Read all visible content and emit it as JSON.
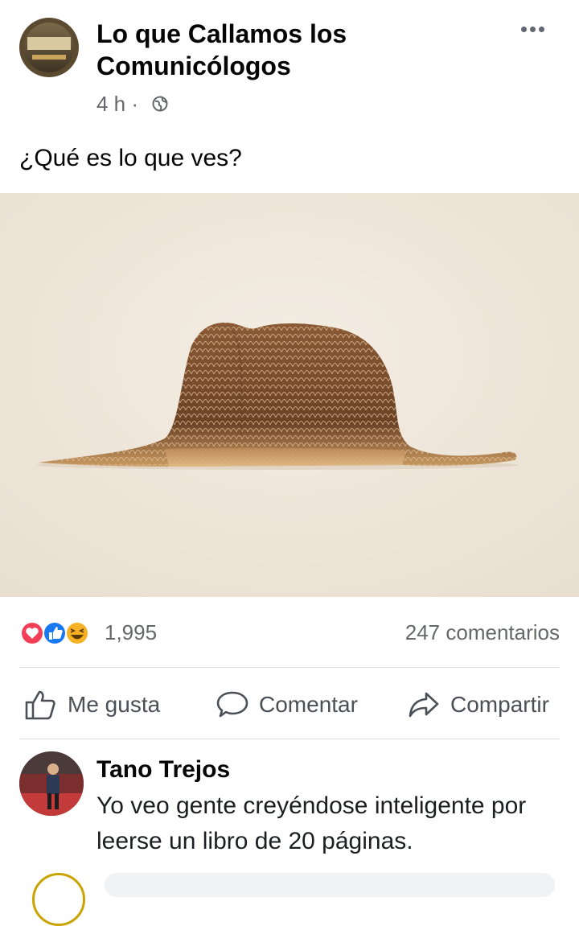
{
  "post": {
    "page_name": "Lo que Callamos los Comunicólogos",
    "time": "4 h ·",
    "privacy_icon": "globe-icon",
    "text": "¿Qué es lo que ves?",
    "photo_subject": "boa-elephant-hat-illustration"
  },
  "reactions": {
    "icons": [
      "love-icon",
      "like-icon",
      "haha-icon"
    ],
    "count": "1,995",
    "comments": "247 comentarios"
  },
  "actions": {
    "like": "Me gusta",
    "comment": "Comentar",
    "share": "Compartir"
  },
  "comment": {
    "author": "Tano Trejos",
    "text": "Yo veo gente creyéndose inteligente por leerse un libro de 20 páginas."
  },
  "colors": {
    "secondary_text": "#65676b",
    "love": "#f33e58",
    "like": "#1877f2",
    "haha": "#f7b125",
    "photo_bg": "#efe7dc"
  }
}
